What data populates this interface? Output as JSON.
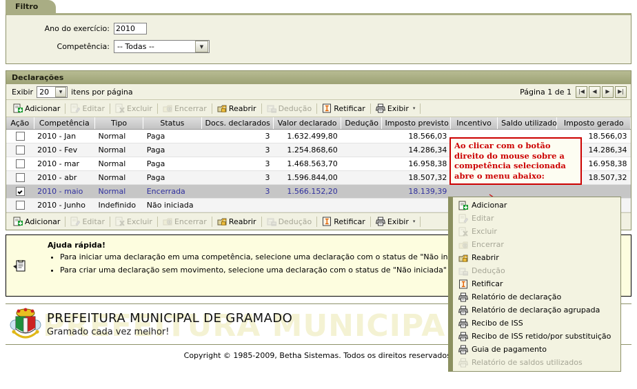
{
  "filtro": {
    "tab_label": "Filtro",
    "ano_label": "Ano do exercício:",
    "ano_value": "2010",
    "competencia_label": "Competência:",
    "competencia_value": "-- Todas --"
  },
  "declaracoes": {
    "title": "Declarações",
    "exibir_prefix": "Exibir",
    "page_size": "20",
    "exibir_suffix": "itens por página",
    "page_info": "Página 1 de 1",
    "pager": {
      "first": "|◀",
      "prev": "◀",
      "next": "▶",
      "last": "▶|"
    },
    "toolbar": [
      {
        "label": "Adicionar",
        "icon": "add-document-icon",
        "enabled": true
      },
      {
        "label": "Editar",
        "icon": "edit-document-icon",
        "enabled": false
      },
      {
        "label": "Excluir",
        "icon": "delete-document-icon",
        "enabled": false
      },
      {
        "label": "Encerrar",
        "icon": "lock-closed-icon",
        "enabled": false
      },
      {
        "label": "Reabrir",
        "icon": "lock-open-icon",
        "enabled": true
      },
      {
        "label": "Dedução",
        "icon": "deduction-icon",
        "enabled": false
      },
      {
        "label": "Retificar",
        "icon": "rectify-icon",
        "enabled": true
      },
      {
        "label": "Exibir",
        "icon": "printer-icon",
        "enabled": true,
        "caret": "▾"
      }
    ],
    "columns": [
      "Ação",
      "Competência",
      "Tipo",
      "Status",
      "Docs. declarados",
      "Valor declarado",
      "Dedução",
      "Imposto previsto",
      "Incentivo",
      "Saldo utilizado",
      "Imposto gerado"
    ],
    "rows": [
      {
        "checked": false,
        "competencia": "2010 - Jan",
        "tipo": "Normal",
        "status": "Paga",
        "docs": "3",
        "valor": "1.632.499,80",
        "deducao": "",
        "previsto": "18.566,03",
        "incentivo": "",
        "saldo": "",
        "gerado": "18.566,03",
        "selected": false
      },
      {
        "checked": false,
        "competencia": "2010 - Fev",
        "tipo": "Normal",
        "status": "Paga",
        "docs": "3",
        "valor": "1.254.868,60",
        "deducao": "",
        "previsto": "14.286,34",
        "incentivo": "",
        "saldo": "",
        "gerado": "14.286,34",
        "selected": false
      },
      {
        "checked": false,
        "competencia": "2010 - mar",
        "tipo": "Normal",
        "status": "Paga",
        "docs": "3",
        "valor": "1.468.563,70",
        "deducao": "",
        "previsto": "16.958,38",
        "incentivo": "",
        "saldo": "",
        "gerado": "16.958,38",
        "selected": false
      },
      {
        "checked": false,
        "competencia": "2010 - abr",
        "tipo": "Normal",
        "status": "Paga",
        "docs": "3",
        "valor": "1.596.844,00",
        "deducao": "",
        "previsto": "18.507,32",
        "incentivo": "",
        "saldo": "",
        "gerado": "18.507,32",
        "selected": false
      },
      {
        "checked": true,
        "competencia": "2010 - maio",
        "tipo": "Normal",
        "status": "Encerrada",
        "docs": "3",
        "valor": "1.566.152,20",
        "deducao": "",
        "previsto": "18.139,39",
        "incentivo": "",
        "saldo": "",
        "gerado": "",
        "selected": true
      },
      {
        "checked": false,
        "competencia": "2010 - Junho",
        "tipo": "Indefinido",
        "status": "Não iniciada",
        "docs": "",
        "valor": "",
        "deducao": "",
        "previsto": "",
        "incentivo": "",
        "saldo": "",
        "gerado": "",
        "selected": false
      }
    ]
  },
  "help": {
    "title": "Ajuda rápida!",
    "items": [
      "Para iniciar uma declaração em uma competência, selecione uma declaração com o status de \"Não iniciada\" e clique em Editar.",
      "Para criar uma declaração sem movimento, selecione uma declaração com o status de \"Não iniciada\" e clique em Encerrar."
    ]
  },
  "callout": {
    "text": "Ao clicar com o botão direito do mouse sobre a competência selecionada abre o menu abaixo:",
    "color": "#cc0000"
  },
  "context_menu": [
    {
      "label": "Adicionar",
      "icon": "add-document-icon",
      "enabled": true
    },
    {
      "label": "Editar",
      "icon": "edit-document-icon",
      "enabled": false
    },
    {
      "label": "Excluir",
      "icon": "delete-document-icon",
      "enabled": false
    },
    {
      "label": "Encerrar",
      "icon": "lock-closed-icon",
      "enabled": false
    },
    {
      "label": "Reabrir",
      "icon": "lock-open-icon",
      "enabled": true
    },
    {
      "label": "Dedução",
      "icon": "deduction-icon",
      "enabled": false
    },
    {
      "label": "Retificar",
      "icon": "rectify-icon",
      "enabled": true
    },
    {
      "label": "Relatório de declaração",
      "icon": "printer-icon",
      "enabled": true
    },
    {
      "label": "Relatório de declaração agrupada",
      "icon": "printer-icon",
      "enabled": true
    },
    {
      "label": "Recibo de ISS",
      "icon": "printer-icon",
      "enabled": true
    },
    {
      "label": "Recibo de ISS retido/por substituição",
      "icon": "printer-icon",
      "enabled": true
    },
    {
      "label": "Guia de pagamento",
      "icon": "printer-icon",
      "enabled": true
    },
    {
      "label": "Relatório de saldos utilizados",
      "icon": "printer-icon",
      "enabled": false
    }
  ],
  "footer": {
    "watermark": "PREFEITURA MUNICIPAL DE",
    "org_name": "PREFEITURA MUNICIPAL DE GRAMADO",
    "slogan": "Gramado cada vez melhor!",
    "copyright": "Copyright © 1985-2009, Betha Sistemas. Todos os direitos reservados."
  }
}
